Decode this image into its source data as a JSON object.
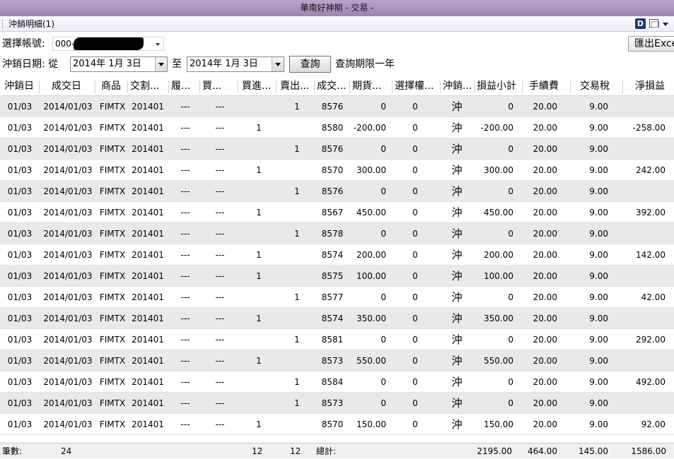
{
  "window": {
    "title": "華南好神期 - 交易 -"
  },
  "toolbar": {
    "tab_label": "沖銷明細(1)",
    "d_icon": "D"
  },
  "filters": {
    "account_label": "選擇帳號:",
    "account_value": "000-",
    "export_label": "匯出Excel",
    "date_label": "沖銷日期: 從",
    "from_date": "2014年  1月  3日",
    "to_label": "至",
    "to_date": "2014年  1月  3日",
    "query_label": "查詢",
    "limit_note": "查詢期限一年"
  },
  "table": {
    "headers": [
      "沖銷日",
      "成交日",
      "商品",
      "交割...",
      "履...",
      "買...",
      "買進...",
      "賣出...",
      "成交...",
      "期貨...",
      "選擇權...",
      "沖銷...",
      "損益小計",
      "手續費",
      "交易稅",
      "淨損益"
    ],
    "rows": [
      [
        "01/03",
        "2014/01/03",
        "FIMTX",
        "201401",
        "---",
        "---",
        "",
        "1",
        "8576",
        "0",
        "0",
        "沖",
        "0",
        "20.00",
        "9.00",
        ""
      ],
      [
        "01/03",
        "2014/01/03",
        "FIMTX",
        "201401",
        "---",
        "---",
        "1",
        "",
        "8580",
        "-200.00",
        "0",
        "沖",
        "-200.00",
        "20.00",
        "9.00",
        "-258.00"
      ],
      [
        "01/03",
        "2014/01/03",
        "FIMTX",
        "201401",
        "---",
        "---",
        "",
        "1",
        "8576",
        "0",
        "0",
        "沖",
        "0",
        "20.00",
        "9.00",
        ""
      ],
      [
        "01/03",
        "2014/01/03",
        "FIMTX",
        "201401",
        "---",
        "---",
        "1",
        "",
        "8570",
        "300.00",
        "0",
        "沖",
        "300.00",
        "20.00",
        "9.00",
        "242.00"
      ],
      [
        "01/03",
        "2014/01/03",
        "FIMTX",
        "201401",
        "---",
        "---",
        "",
        "1",
        "8576",
        "0",
        "0",
        "沖",
        "0",
        "20.00",
        "9.00",
        ""
      ],
      [
        "01/03",
        "2014/01/03",
        "FIMTX",
        "201401",
        "---",
        "---",
        "1",
        "",
        "8567",
        "450.00",
        "0",
        "沖",
        "450.00",
        "20.00",
        "9.00",
        "392.00"
      ],
      [
        "01/03",
        "2014/01/03",
        "FIMTX",
        "201401",
        "---",
        "---",
        "",
        "1",
        "8578",
        "0",
        "0",
        "沖",
        "0",
        "20.00",
        "9.00",
        ""
      ],
      [
        "01/03",
        "2014/01/03",
        "FIMTX",
        "201401",
        "---",
        "---",
        "1",
        "",
        "8574",
        "200.00",
        "0",
        "沖",
        "200.00",
        "20.00",
        "9.00",
        "142.00"
      ],
      [
        "01/03",
        "2014/01/03",
        "FIMTX",
        "201401",
        "---",
        "---",
        "1",
        "",
        "8575",
        "100.00",
        "0",
        "沖",
        "100.00",
        "20.00",
        "9.00",
        ""
      ],
      [
        "01/03",
        "2014/01/03",
        "FIMTX",
        "201401",
        "---",
        "---",
        "",
        "1",
        "8577",
        "0",
        "0",
        "沖",
        "0",
        "20.00",
        "9.00",
        "42.00"
      ],
      [
        "01/03",
        "2014/01/03",
        "FIMTX",
        "201401",
        "---",
        "---",
        "1",
        "",
        "8574",
        "350.00",
        "0",
        "沖",
        "350.00",
        "20.00",
        "9.00",
        ""
      ],
      [
        "01/03",
        "2014/01/03",
        "FIMTX",
        "201401",
        "---",
        "---",
        "",
        "1",
        "8581",
        "0",
        "0",
        "沖",
        "0",
        "20.00",
        "9.00",
        "292.00"
      ],
      [
        "01/03",
        "2014/01/03",
        "FIMTX",
        "201401",
        "---",
        "---",
        "1",
        "",
        "8573",
        "550.00",
        "0",
        "沖",
        "550.00",
        "20.00",
        "9.00",
        ""
      ],
      [
        "01/03",
        "2014/01/03",
        "FIMTX",
        "201401",
        "---",
        "---",
        "",
        "1",
        "8584",
        "0",
        "0",
        "沖",
        "0",
        "20.00",
        "9.00",
        "492.00"
      ],
      [
        "01/03",
        "2014/01/03",
        "FIMTX",
        "201401",
        "---",
        "---",
        "",
        "1",
        "8573",
        "0",
        "0",
        "沖",
        "0",
        "20.00",
        "9.00",
        ""
      ],
      [
        "01/03",
        "2014/01/03",
        "FIMTX",
        "201401",
        "---",
        "---",
        "1",
        "",
        "8570",
        "150.00",
        "0",
        "沖",
        "150.00",
        "20.00",
        "9.00",
        "92.00"
      ]
    ]
  },
  "footer": {
    "count_label": "筆數:",
    "count_value": "24",
    "buy_total": "12",
    "sell_total": "12",
    "total_label": "總計:",
    "pnl_total": "2195.00",
    "fee_total": "464.00",
    "tax_total": "145.00",
    "net_total": "1586.00"
  },
  "colors": {
    "row_alt": "#e9e9e9",
    "row_white": "#ffffff",
    "titlebar": "#9c86b0"
  }
}
